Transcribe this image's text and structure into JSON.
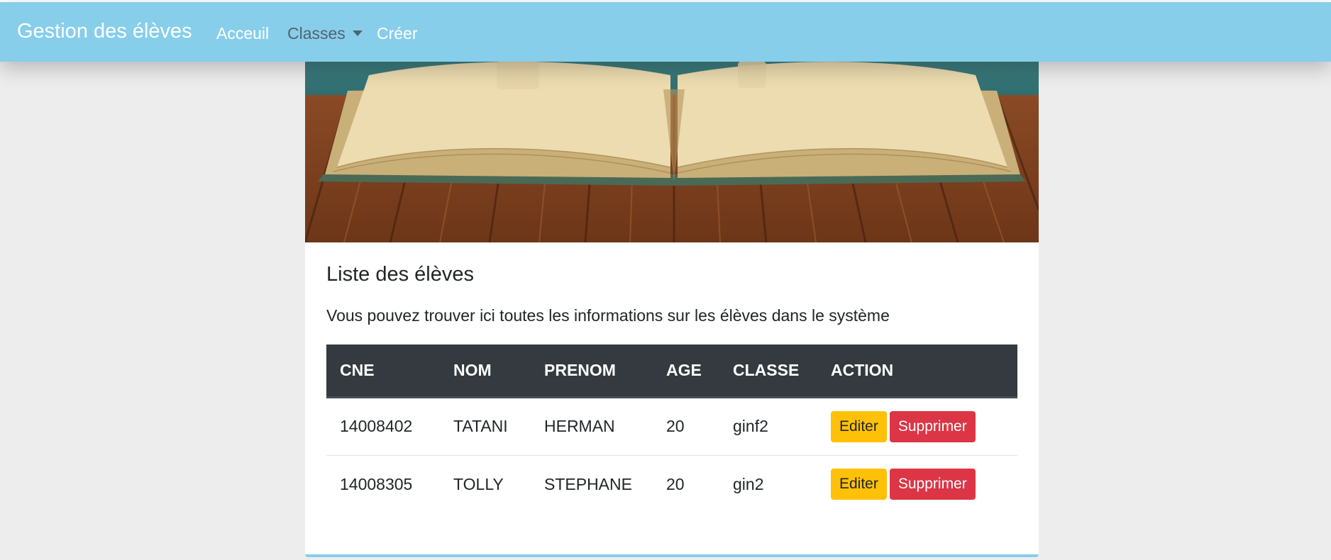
{
  "navbar": {
    "brand": "Gestion des élèves",
    "links": [
      {
        "label": "Acceuil"
      },
      {
        "label": "Classes"
      },
      {
        "label": "Créer"
      }
    ]
  },
  "card": {
    "title": "Liste des élèves",
    "text": "Vous pouvez trouver ici toutes les informations sur les élèves dans le système"
  },
  "table": {
    "headers": [
      "CNE",
      "NOM",
      "PRENOM",
      "AGE",
      "CLASSE",
      "ACTION"
    ],
    "rows": [
      {
        "cne": "14008402",
        "nom": "TATANI",
        "prenom": "HERMAN",
        "age": "20",
        "classe": "ginf2"
      },
      {
        "cne": "14008305",
        "nom": "TOLLY",
        "prenom": "STEPHANE",
        "age": "20",
        "classe": "gin2"
      }
    ],
    "edit_label": "Editer",
    "delete_label": "Supprimer"
  },
  "colors": {
    "navbar": "#87ceeb",
    "table_header": "#343a40",
    "edit_button": "#ffc107",
    "delete_button": "#dc3545",
    "page_background": "#ededed"
  },
  "icons": [
    "caret-down-icon"
  ]
}
